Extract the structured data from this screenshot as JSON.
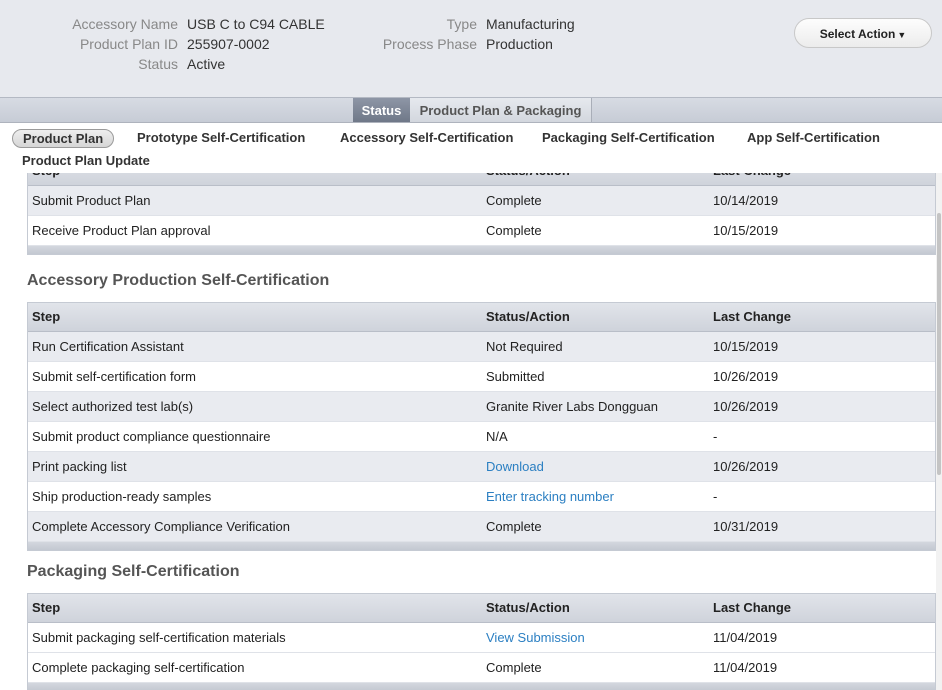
{
  "header": {
    "accessory_name_label": "Accessory Name",
    "accessory_name": "USB C to C94 CABLE",
    "product_plan_id_label": "Product Plan ID",
    "product_plan_id": "255907-0002",
    "status_label": "Status",
    "status": "Active",
    "type_label": "Type",
    "type": "Manufacturing",
    "process_phase_label": "Process Phase",
    "process_phase": "Production",
    "select_action": "Select Action",
    "select_action_icon": "caret-down"
  },
  "tabs": {
    "status": "Status",
    "product_plan_packaging": "Product Plan & Packaging"
  },
  "subnav": {
    "product_plan": "Product Plan",
    "prototype": "Prototype Self-Certification",
    "accessory": "Accessory Self-Certification",
    "packaging": "Packaging Self-Certification",
    "app": "App Self-Certification",
    "update": "Product Plan Update"
  },
  "columns": {
    "step": "Step",
    "status": "Status/Action",
    "last_change": "Last Change"
  },
  "product_plan_table": {
    "rows": [
      {
        "step": "Submit Product Plan",
        "status": "Complete",
        "date": "10/14/2019"
      },
      {
        "step": "Receive Product Plan approval",
        "status": "Complete",
        "date": "10/15/2019"
      }
    ]
  },
  "accessory_section": {
    "title": "Accessory Production Self-Certification",
    "rows": [
      {
        "step": "Run Certification Assistant",
        "status": "Not Required",
        "date": "10/15/2019"
      },
      {
        "step": "Submit self-certification form",
        "status": "Submitted",
        "date": "10/26/2019"
      },
      {
        "step": "Select authorized test lab(s)",
        "status": "Granite River Labs Dongguan",
        "date": "10/26/2019"
      },
      {
        "step": "Submit product compliance questionnaire",
        "status": "N/A",
        "date": "-"
      },
      {
        "step": "Print packing list",
        "status": "Download",
        "date": "10/26/2019"
      },
      {
        "step": "Ship production-ready samples",
        "status": "Enter tracking number",
        "date": "-"
      },
      {
        "step": "Complete Accessory Compliance Verification",
        "status": "Complete",
        "date": "10/31/2019"
      }
    ]
  },
  "packaging_section": {
    "title": "Packaging Self-Certification",
    "rows": [
      {
        "step": "Submit packaging self-certification materials",
        "status": "View Submission",
        "date": "11/04/2019"
      },
      {
        "step": "Complete packaging self-certification",
        "status": "Complete",
        "date": "11/04/2019"
      }
    ]
  },
  "colors": {
    "link": "#2b7fc2",
    "active_tab": "#6f7888",
    "header_bg": "#e7e9ee"
  }
}
